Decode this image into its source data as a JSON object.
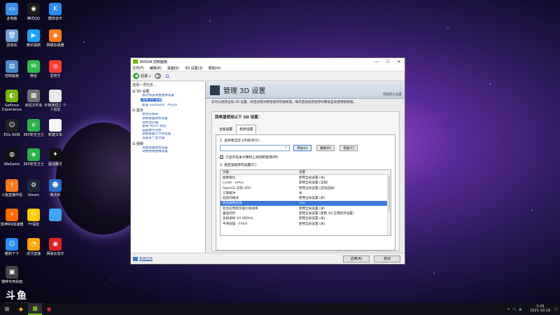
{
  "desktop_icons": [
    {
      "label": "此电脑",
      "color": "#3a8ee6",
      "glyph": "▭"
    },
    {
      "label": "腾讯QQ",
      "color": "#1b1b1b",
      "glyph": "◉"
    },
    {
      "label": "酷狗音乐",
      "color": "#2a8bf2",
      "glyph": "K"
    },
    {
      "label": "回收站",
      "color": "#6fa0d8",
      "glyph": "🗑"
    },
    {
      "label": "腾讯视频",
      "color": "#19a3ff",
      "glyph": "▶"
    },
    {
      "label": "网络加速器",
      "color": "#ff7a1a",
      "glyph": "◆"
    },
    {
      "label": "控制面板",
      "color": "#4a86c8",
      "glyph": "▤"
    },
    {
      "label": "微信",
      "color": "#2dbb4b",
      "glyph": "✉"
    },
    {
      "label": "爱奇艺",
      "color": "#ff3b30",
      "glyph": "◎"
    },
    {
      "label": "GeForce Experience",
      "color": "#76b900",
      "glyph": "◐"
    },
    {
      "label": "单机文件夹",
      "color": "#707070",
      "glyph": "▦"
    },
    {
      "label": "手柄按钮工 个人信息",
      "color": "#e6e6e6",
      "glyph": "▯"
    },
    {
      "label": "EOL·SKIN",
      "color": "#222",
      "glyph": "☺"
    },
    {
      "label": "360安全卫士",
      "color": "#2ab24a",
      "glyph": "e"
    },
    {
      "label": "新建文本",
      "color": "#f5f5f5",
      "glyph": "▯"
    },
    {
      "label": "WeGame",
      "color": "#111",
      "glyph": "◍"
    },
    {
      "label": "360安全卫士",
      "color": "#2ab24a",
      "glyph": "◈"
    },
    {
      "label": "驱动精灵",
      "color": "#111",
      "glyph": "✦"
    },
    {
      "label": "斗鱼直播伴侣",
      "color": "#ff7a1a",
      "glyph": "?"
    },
    {
      "label": "Steam",
      "color": "#1b2838",
      "glyph": "⚙"
    },
    {
      "label": "鲁大师",
      "color": "#2a6dc8",
      "glyph": "☻"
    },
    {
      "label": "雷神NN加速器",
      "color": "#ff6a00",
      "glyph": "⚡"
    },
    {
      "label": "YY语音",
      "color": "#ffcc00",
      "glyph": "⚇"
    },
    {
      "label": "",
      "color": "#3ba7f5",
      "glyph": ""
    },
    {
      "label": "酷狗下下",
      "color": "#2a8bf2",
      "glyph": "☺"
    },
    {
      "label": "虎牙直播",
      "color": "#ffa500",
      "glyph": "◔"
    },
    {
      "label": "网易云音乐",
      "color": "#e02020",
      "glyph": "◉"
    },
    {
      "label": "猫咪专用桌面",
      "color": "#444",
      "glyph": "▣"
    }
  ],
  "watermark": {
    "big": "斗鱼",
    "small": "DOUYU.COM"
  },
  "window": {
    "title": "NVIDIA 控制面板",
    "menu": [
      "文件(F)",
      "编辑(E)",
      "桌面(K)",
      "3D 设置(3)",
      "帮助(H)"
    ],
    "toolbar": {
      "back": "后退",
      "forward": "",
      "home": ""
    },
    "left_header": "选择一项任务...",
    "tree": [
      {
        "group": "3D 设置",
        "items": [
          "通过预览调整图像设置",
          "管理 3D 设置",
          "配置 Surround、PhysX"
        ],
        "selected_index": 1
      },
      {
        "group": "显示",
        "items": [
          "更改分辨率",
          "调整桌面颜色设置",
          "旋转显示器",
          "查看 HDCP 状态",
          "设置数字音频",
          "调整桌面尺寸和位置",
          "设置多个显示器"
        ]
      },
      {
        "group": "视频",
        "items": [
          "调整视频颜色设置",
          "调整视频图像设置"
        ]
      }
    ],
    "banner_title": "管理 3D 设置",
    "restore_defaults": "恢复默认设置",
    "description": "您可以更改全局 3D 设置，并且创建对特定程序的替换值。每次启动指定程序时都会自动使用替换值。",
    "panel_title": "我希望使用以下 3D 设置：",
    "tabs": [
      {
        "label": "全局设置",
        "active": false
      },
      {
        "label": "程序设置",
        "active": true
      }
    ],
    "step1": "1. 选择要自定义的程序(S)：",
    "add_button": "添加(D)",
    "remove_button": "删除(R)",
    "restore_button": "恢复(T)",
    "show_only_checkbox": "只显示在本计算机上找到的程序(M)",
    "step2": "2. 指定该程序的设置(C)：",
    "table": {
      "headers": [
        "功能",
        "设置"
      ],
      "rows": [
        [
          "图像锐化",
          "使用全局设置 (关)"
        ],
        [
          "CUDA - GPUs",
          "使用全局设置 (全部)"
        ],
        [
          "OpenGL 渲染 GPU",
          "使用全局设置 (自动选择)"
        ],
        [
          "三重缓冲",
          "关"
        ],
        [
          "低延时模式",
          "使用全局设置 (关)"
        ],
        [
          "各向异性过滤",
          "16x"
        ],
        [
          "后台应用程序最大帧速率",
          "使用全局设置 (关)"
        ],
        [
          "垂直同步",
          "使用全局设置 (使用 3D 应用程序设置)"
        ],
        [
          "多帧采样 AA (MFAA)",
          "使用全局设置 (关)"
        ],
        [
          "平滑处理 - FXAA",
          "使用全局设置 (关)"
        ]
      ],
      "highlight_index": 5
    },
    "system_info": "系统信息",
    "apply": "应用(A)",
    "cancel": "取消"
  },
  "taskbar": {
    "time": "3:29",
    "date": "2021-10-18"
  }
}
